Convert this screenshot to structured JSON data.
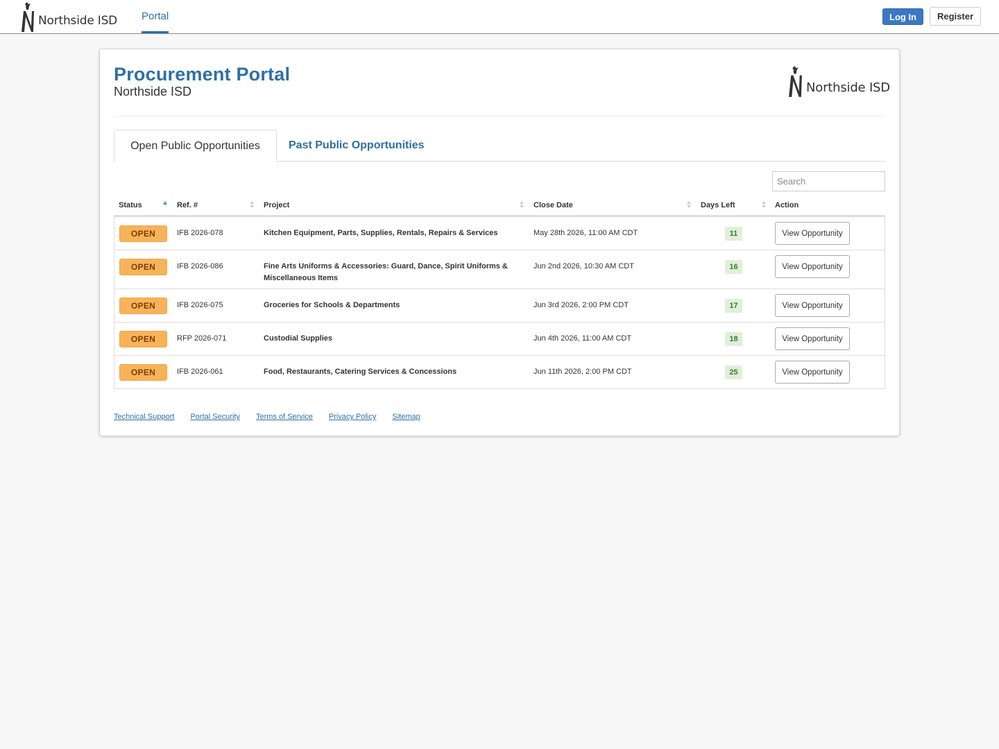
{
  "nav": {
    "brand": "Northside ISD",
    "portal_tab": "Portal",
    "login_label": "Log In",
    "register_label": "Register"
  },
  "header": {
    "title": "Procurement Portal",
    "subtitle": "Northside ISD",
    "logo_text": "Northside ISD"
  },
  "tabs": [
    {
      "label": "Open Public Opportunities",
      "active": true
    },
    {
      "label": "Past Public Opportunities",
      "active": false
    }
  ],
  "search": {
    "placeholder": "Search"
  },
  "table": {
    "columns": [
      "Status",
      "Ref. #",
      "Project",
      "Close Date",
      "Days Left",
      "Action"
    ],
    "rows": [
      {
        "status": "OPEN",
        "ref": "IFB 2026-078",
        "project": "Kitchen Equipment, Parts, Supplies, Rentals, Repairs & Services",
        "close": "May 28th 2026, 11:00 AM CDT",
        "days": "11",
        "action": "View Opportunity"
      },
      {
        "status": "OPEN",
        "ref": "IFB 2026-086",
        "project": "Fine Arts Uniforms & Accessories: Guard, Dance, Spirit Uniforms & Miscellaneous Items",
        "close": "Jun 2nd 2026, 10:30 AM CDT",
        "days": "16",
        "action": "View Opportunity"
      },
      {
        "status": "OPEN",
        "ref": "IFB 2026-075",
        "project": "Groceries for Schools & Departments",
        "close": "Jun 3rd 2026, 2:00 PM CDT",
        "days": "17",
        "action": "View Opportunity"
      },
      {
        "status": "OPEN",
        "ref": "RFP 2026-071",
        "project": "Custodial Supplies",
        "close": "Jun 4th 2026, 11:00 AM CDT",
        "days": "18",
        "action": "View Opportunity"
      },
      {
        "status": "OPEN",
        "ref": "IFB 2026-061",
        "project": "Food, Restaurants, Catering Services & Concessions",
        "close": "Jun 11th 2026, 2:00 PM CDT",
        "days": "25",
        "action": "View Opportunity"
      }
    ]
  },
  "footer": {
    "links": [
      "Technical Support",
      "Portal Security",
      "Terms of Service",
      "Privacy Policy",
      "Sitemap"
    ]
  },
  "colors": {
    "brand_blue": "#2f6fa7",
    "login_blue": "#3a78c3",
    "status_open": "#f8b35a",
    "days_bg": "#dff0d8",
    "days_text": "#3c763d"
  }
}
